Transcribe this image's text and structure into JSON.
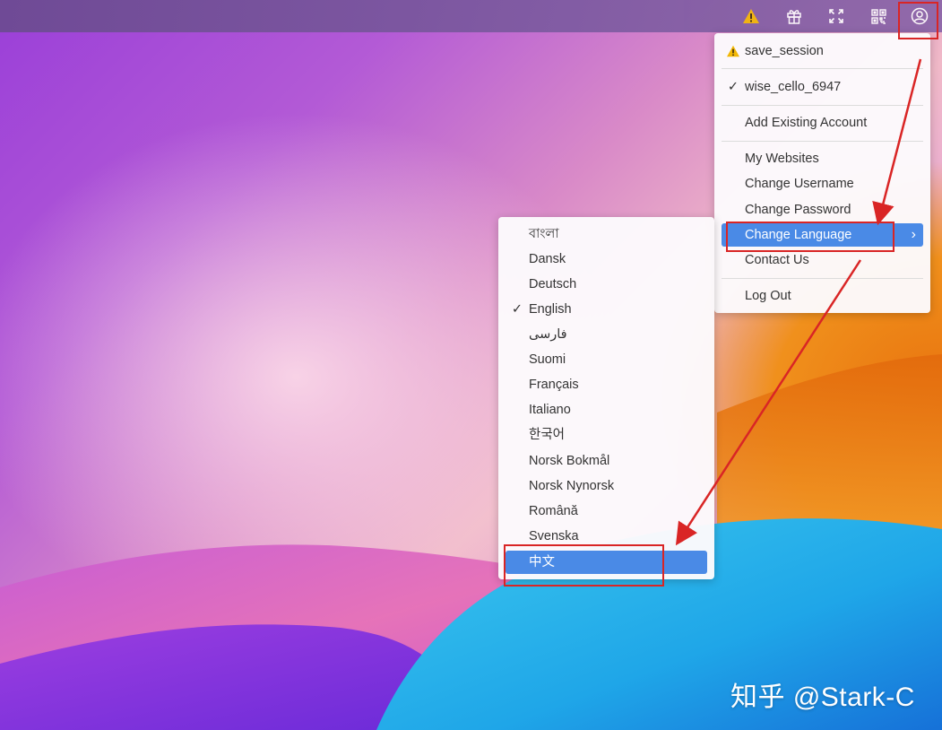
{
  "topbar": {
    "icons": [
      {
        "name": "warning-icon",
        "color": "#f2b705"
      },
      {
        "name": "gift-icon"
      },
      {
        "name": "fullscreen-icon"
      },
      {
        "name": "qr-code-icon"
      },
      {
        "name": "user-account-icon"
      }
    ]
  },
  "account_menu": {
    "warning_item": "save_session",
    "current_account": "wise_cello_6947",
    "add_existing": "Add Existing Account",
    "items": [
      "My Websites",
      "Change Username",
      "Change Password",
      "Change Language",
      "Contact Us"
    ],
    "highlighted": "Change Language",
    "logout": "Log Out",
    "highlight_color": "#4a8ae6"
  },
  "language_menu": {
    "languages": [
      "বাংলা",
      "Dansk",
      "Deutsch",
      "English",
      "فارسی",
      "Suomi",
      "Français",
      "Italiano",
      "한국어",
      "Norsk Bokmål",
      "Norsk Nynorsk",
      "Română",
      "Svenska",
      "中文"
    ],
    "checked": "English",
    "highlighted": "中文"
  },
  "watermark": "知乎 @Stark-C",
  "annotation_color": "#d92525"
}
